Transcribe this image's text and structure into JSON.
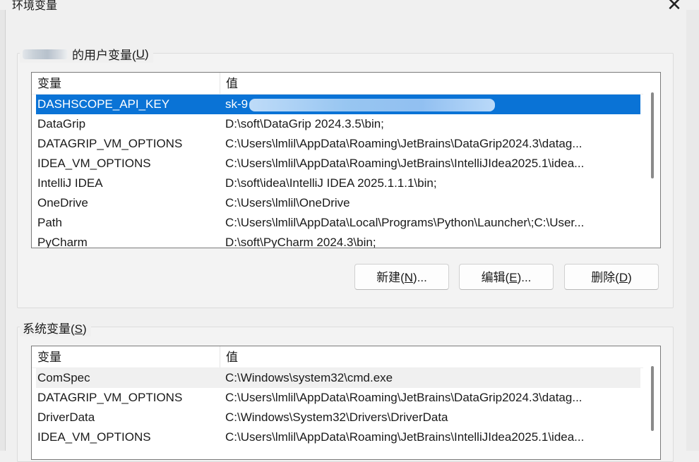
{
  "window": {
    "title": "环境变量",
    "close_glyph": "✕"
  },
  "user_vars": {
    "legend_suffix": "的用户变量(",
    "legend_key": "U",
    "legend_close": ")",
    "header": {
      "variable": "变量",
      "value": "值"
    },
    "rows": [
      {
        "name": "DASHSCOPE_API_KEY",
        "value": "sk-9",
        "selected": true
      },
      {
        "name": "DataGrip",
        "value": "D:\\soft\\DataGrip 2024.3.5\\bin;"
      },
      {
        "name": "DATAGRIP_VM_OPTIONS",
        "value": "C:\\Users\\lmlil\\AppData\\Roaming\\JetBrains\\DataGrip2024.3\\datag..."
      },
      {
        "name": "IDEA_VM_OPTIONS",
        "value": "C:\\Users\\lmlil\\AppData\\Roaming\\JetBrains\\IntelliJIdea2025.1\\idea..."
      },
      {
        "name": "IntelliJ IDEA",
        "value": "D:\\soft\\idea\\IntelliJ IDEA 2025.1.1.1\\bin;"
      },
      {
        "name": "OneDrive",
        "value": "C:\\Users\\lmlil\\OneDrive"
      },
      {
        "name": "Path",
        "value": "C:\\Users\\lmlil\\AppData\\Local\\Programs\\Python\\Launcher\\;C:\\User..."
      },
      {
        "name": "PyCharm",
        "value": "D:\\soft\\PyCharm 2024.3\\bin;"
      }
    ],
    "buttons": {
      "new": {
        "pre": "新建(",
        "key": "N",
        "post": ")..."
      },
      "edit": {
        "pre": "编辑(",
        "key": "E",
        "post": ")..."
      },
      "delete": {
        "pre": "删除(",
        "key": "D",
        "post": ")"
      }
    }
  },
  "system_vars": {
    "legend_pre": "系统变量(",
    "legend_key": "S",
    "legend_close": ")",
    "header": {
      "variable": "变量",
      "value": "值"
    },
    "rows": [
      {
        "name": "ComSpec",
        "value": "C:\\Windows\\system32\\cmd.exe",
        "hover": true
      },
      {
        "name": "DATAGRIP_VM_OPTIONS",
        "value": "C:\\Users\\lmlil\\AppData\\Roaming\\JetBrains\\DataGrip2024.3\\datag..."
      },
      {
        "name": "DriverData",
        "value": "C:\\Windows\\System32\\Drivers\\DriverData"
      },
      {
        "name": "IDEA_VM_OPTIONS",
        "value": "C:\\Users\\lmlil\\AppData\\Roaming\\JetBrains\\IntelliJIdea2025.1\\idea..."
      }
    ]
  },
  "colors": {
    "selection": "#0a73d6",
    "background": "#f0f0f0"
  }
}
